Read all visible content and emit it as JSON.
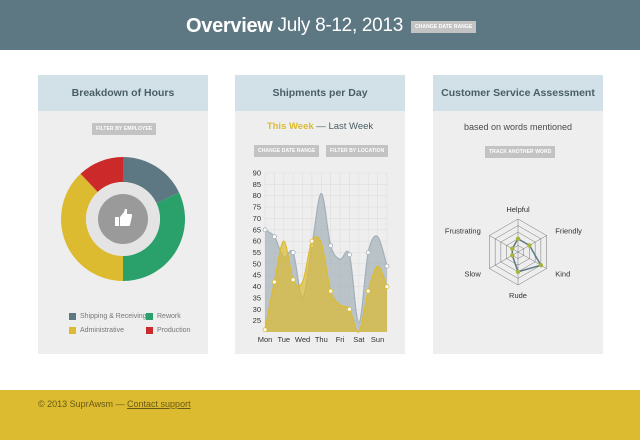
{
  "header": {
    "title": "Overview",
    "date_range": "July 8-12, 2013",
    "change_date_button": "CHANGE DATE RANGE"
  },
  "panels": {
    "hours": {
      "title": "Breakdown of Hours",
      "filter_button": "FILTER BY EMPLOYEE",
      "center_icon": "thumbs-up-icon",
      "legend": [
        {
          "label": "Shipping & Receiving",
          "color": "#5d7882"
        },
        {
          "label": "Rework",
          "color": "#2aa06a"
        },
        {
          "label": "Administrative",
          "color": "#dcbb30"
        },
        {
          "label": "Production",
          "color": "#cc2a2a"
        }
      ]
    },
    "shipments": {
      "title": "Shipments per Day",
      "this_week": "This Week",
      "separator": "—",
      "last_week": "Last Week",
      "change_date_button": "CHANGE DATE RANGE",
      "filter_button": "FILTER BY LOCATION"
    },
    "customer": {
      "title": "Customer Service Assessment",
      "subtitle": "based on words mentioned",
      "track_button": "TRACK ANOTHER WORD"
    }
  },
  "footer": {
    "copyright": "© 2013 SuprAwsm —",
    "link": "Contact support"
  },
  "chart_data": [
    {
      "type": "pie",
      "categories": [
        "Shipping & Receiving",
        "Rework",
        "Administrative",
        "Production"
      ],
      "values": [
        18,
        32,
        38,
        12
      ],
      "colors": [
        "#5d7882",
        "#2aa06a",
        "#dcbb30",
        "#cc2a2a"
      ],
      "donut": true
    },
    {
      "type": "area",
      "categories": [
        "Mon",
        "Tue",
        "Wed",
        "Thu",
        "Fri",
        "Sat",
        "Sun"
      ],
      "x": [
        "Mon",
        "Mon",
        "Tue",
        "Tue",
        "Wed",
        "Wed",
        "Thu",
        "Thu",
        "Fri",
        "Fri",
        "Sat",
        "Sat",
        "Sun",
        "Sun"
      ],
      "series": [
        {
          "name": "Last Week",
          "color": "#a3b0b8",
          "values": [
            65,
            62,
            53,
            55,
            35,
            58,
            81,
            58,
            52,
            54,
            24,
            55,
            62,
            49
          ]
        },
        {
          "name": "This Week",
          "color": "#dcbb30",
          "values": [
            21,
            42,
            60,
            43,
            42,
            60,
            59,
            38,
            32,
            30,
            20,
            38,
            49,
            40
          ]
        }
      ],
      "yticks": [
        25,
        30,
        35,
        40,
        45,
        50,
        55,
        60,
        65,
        70,
        75,
        80,
        85,
        90
      ],
      "ylim": [
        20,
        90
      ],
      "grid": true
    },
    {
      "type": "radar",
      "categories": [
        "Helpful",
        "Friendly",
        "Kind",
        "Rude",
        "Slow",
        "Frustrating"
      ],
      "values": [
        2,
        2,
        4,
        3,
        1,
        1
      ],
      "max": 5,
      "series_color": "#5d7882",
      "point_color": "#a8b43c"
    }
  ]
}
